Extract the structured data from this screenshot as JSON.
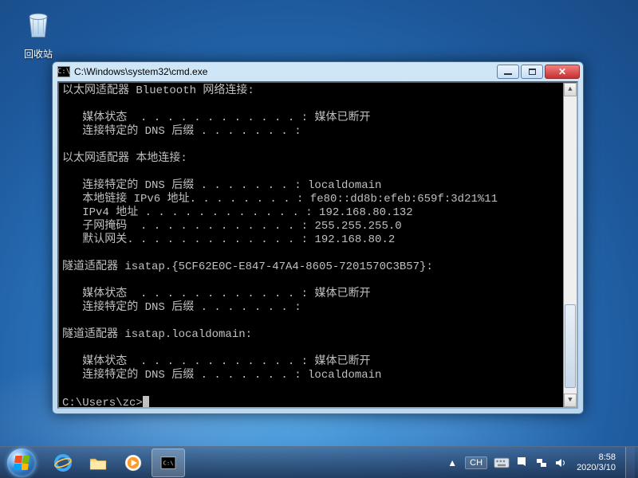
{
  "desktop": {
    "recycle_bin_label": "回收站"
  },
  "window": {
    "title": "C:\\Windows\\system32\\cmd.exe"
  },
  "terminal": {
    "adapter1_header": "以太网适配器 Bluetooth 网络连接:",
    "adapter1_media": "   媒体状态  . . . . . . . . . . . . : 媒体已断开",
    "adapter1_dns": "   连接特定的 DNS 后缀 . . . . . . . :",
    "adapter2_header": "以太网适配器 本地连接:",
    "adapter2_dns": "   连接特定的 DNS 后缀 . . . . . . . : localdomain",
    "adapter2_ipv6": "   本地链接 IPv6 地址. . . . . . . . : fe80::dd8b:efeb:659f:3d21%11",
    "adapter2_ipv4": "   IPv4 地址 . . . . . . . . . . . . : 192.168.80.132",
    "adapter2_mask": "   子网掩码  . . . . . . . . . . . . : 255.255.255.0",
    "adapter2_gw": "   默认网关. . . . . . . . . . . . . : 192.168.80.2",
    "adapter3_header": "隧道适配器 isatap.{5CF62E0C-E847-47A4-8605-7201570C3B57}:",
    "adapter3_media": "   媒体状态  . . . . . . . . . . . . : 媒体已断开",
    "adapter3_dns": "   连接特定的 DNS 后缀 . . . . . . . :",
    "adapter4_header": "隧道适配器 isatap.localdomain:",
    "adapter4_media": "   媒体状态  . . . . . . . . . . . . : 媒体已断开",
    "adapter4_dns": "   连接特定的 DNS 后缀 . . . . . . . : localdomain",
    "prompt": "C:\\Users\\zc>"
  },
  "taskbar": {
    "ime_label": "CH",
    "time": "8:58",
    "date": "2020/3/10"
  }
}
